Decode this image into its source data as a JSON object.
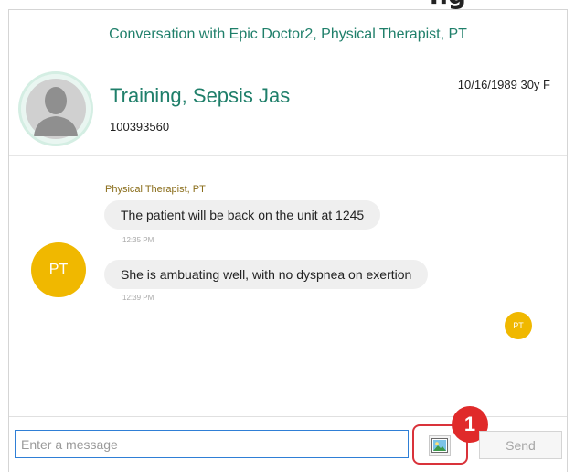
{
  "header": {
    "clipped_heading": "ng"
  },
  "conversation": {
    "title": "Conversation with Epic Doctor2, Physical Therapist, PT"
  },
  "patient": {
    "name": "Training, Sepsis Jas",
    "mrn": "100393560",
    "demographics": "10/16/1989 30y F"
  },
  "messages": {
    "sender_label": "Physical Therapist, PT",
    "avatar_initials": "PT",
    "items": [
      {
        "text": "The patient will be back on the unit at 1245",
        "time": "12:35 PM"
      },
      {
        "text": "She is ambuating well, with no dyspnea on exertion",
        "time": "12:39 PM"
      }
    ],
    "self_avatar_initials": "PT"
  },
  "composer": {
    "placeholder": "Enter a message",
    "value": "",
    "send_label": "Send",
    "step_badge": "1"
  },
  "colors": {
    "accent_green": "#1f7f6a",
    "avatar_gold": "#f0b800",
    "input_border_blue": "#2f7fd6",
    "highlight_red": "#d9323a"
  }
}
